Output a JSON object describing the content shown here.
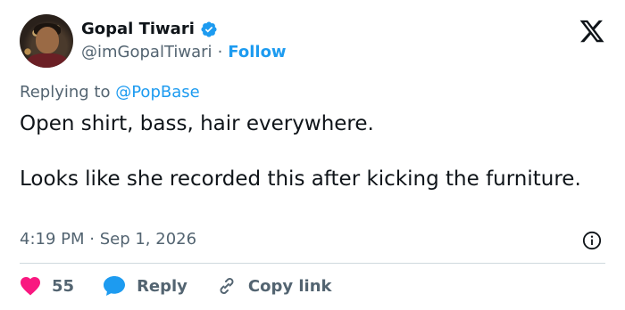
{
  "author": {
    "display_name": "Gopal Tiwari",
    "handle": "@imGopalTiwari",
    "separator": "·",
    "follow_label": "Follow"
  },
  "reply_context": {
    "prefix": "Replying to",
    "mention": "@PopBase"
  },
  "tweet": {
    "paragraph_1": "Open shirt, bass, hair everywhere.",
    "paragraph_2": "Looks like she recorded this after kicking the furniture.",
    "timestamp": "4:19 PM · Sep 1, 2026"
  },
  "actions": {
    "like_count": "55",
    "reply_label": "Reply",
    "copy_link_label": "Copy link"
  },
  "icons": {
    "brand": "x-logo-icon",
    "verified": "verified-badge-icon",
    "info": "info-icon",
    "like": "heart-icon",
    "reply": "speech-bubble-icon",
    "copy": "link-icon"
  },
  "colors": {
    "accent": "#1d9bf0",
    "like": "#f91880",
    "text": "#0f1419",
    "muted": "#536471",
    "divider": "#cfd9de"
  }
}
